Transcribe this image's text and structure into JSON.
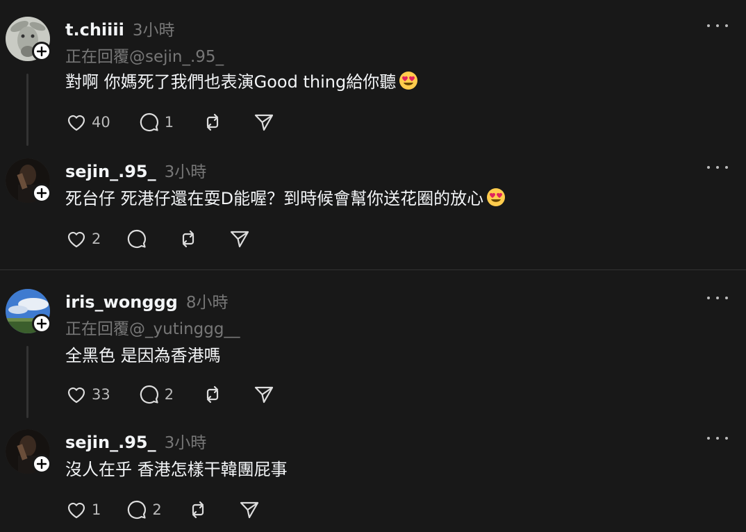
{
  "colors": {
    "background": "#181818",
    "text": "#f3f5f7",
    "muted": "#777777",
    "divider": "#333333"
  },
  "posts": [
    {
      "username": "t.chiiii",
      "time": "3小時",
      "reply_to": "正在回覆@sejin_.95_",
      "text": "對啊 你媽死了我們也表演Good thing給你聽",
      "emoji": "smiling-face-with-heart-eyes",
      "likes": "40",
      "comments": "1"
    },
    {
      "username": "sejin_.95_",
      "time": "3小時",
      "text": "死台仔 死港仔還在耍D能喔？到時候會幫你送花圈的放心",
      "emoji": "smiling-face-with-heart-eyes",
      "likes": "2",
      "comments": ""
    },
    {
      "username": "iris_wonggg",
      "time": "8小時",
      "reply_to": "正在回覆@_yutinggg__",
      "text": "全黑色 是因為香港嗎",
      "likes": "33",
      "comments": "2"
    },
    {
      "username": "sejin_.95_",
      "time": "3小時",
      "text": "沒人在乎 香港怎樣干韓團屁事",
      "likes": "1",
      "comments": "2"
    }
  ]
}
